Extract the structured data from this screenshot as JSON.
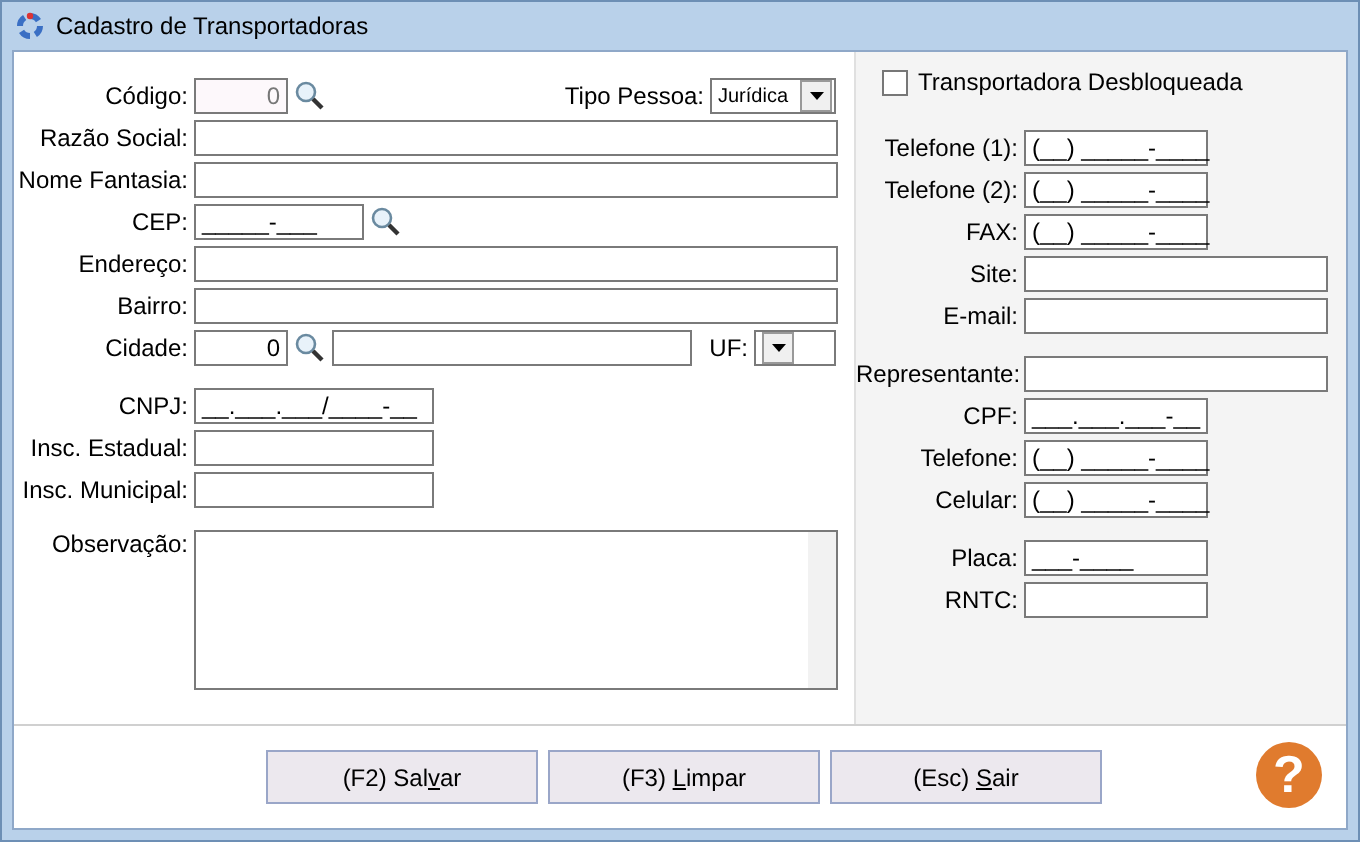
{
  "window": {
    "title": "Cadastro de Transportadoras"
  },
  "left_fields": [
    {
      "label": "Código:",
      "kind": "code",
      "value": "0",
      "disabled": true,
      "search": true,
      "extra": {
        "label": "Tipo Pessoa:",
        "value": "Jurídica"
      }
    },
    {
      "label": "Razão Social:",
      "kind": "wide"
    },
    {
      "label": "Nome Fantasia:",
      "kind": "wide"
    },
    {
      "label": "CEP:",
      "kind": "cep",
      "value": "_____-___",
      "search": true
    },
    {
      "label": "Endereço:",
      "kind": "wide"
    },
    {
      "label": "Bairro:",
      "kind": "wide"
    },
    {
      "label": "Cidade:",
      "kind": "city",
      "value": "0",
      "search": true,
      "extra": {
        "label": "UF:"
      }
    },
    {
      "label": "CNPJ:",
      "kind": "medium",
      "value": "__.___.___/____-__",
      "gap_before": true
    },
    {
      "label": "Insc. Estadual:",
      "kind": "medium"
    },
    {
      "label": "Insc. Municipal:",
      "kind": "medium"
    },
    {
      "label": "Observação:",
      "kind": "memo",
      "gap_before": true
    }
  ],
  "checkbox": {
    "label": "Transportadora Desbloqueada",
    "checked": false
  },
  "right_fields": [
    {
      "label": "Telefone (1):",
      "kind": "short",
      "value": "(__) _____-____",
      "gap_before": true
    },
    {
      "label": "Telefone (2):",
      "kind": "short",
      "value": "(__) _____-____"
    },
    {
      "label": "FAX:",
      "kind": "short",
      "value": "(__) _____-____"
    },
    {
      "label": "Site:",
      "kind": "wide"
    },
    {
      "label": "E-mail:",
      "kind": "wide"
    },
    {
      "label": "Representante:",
      "kind": "wide",
      "gap_before": true
    },
    {
      "label": "CPF:",
      "kind": "short",
      "value": "___.___.___-__"
    },
    {
      "label": "Telefone:",
      "kind": "short",
      "value": "(__) _____-____"
    },
    {
      "label": "Celular:",
      "kind": "short",
      "value": "(__) _____-____"
    },
    {
      "label": "Placa:",
      "kind": "short",
      "value": "___-____",
      "gap_before": true
    },
    {
      "label": "RNTC:",
      "kind": "short"
    }
  ],
  "buttons": [
    {
      "before": "(F2) Sal",
      "key": "v",
      "after": "ar"
    },
    {
      "before": "(F3) ",
      "key": "L",
      "after": "impar"
    },
    {
      "before": "(Esc) ",
      "key": "S",
      "after": "air"
    }
  ],
  "help": {
    "label": "?"
  }
}
